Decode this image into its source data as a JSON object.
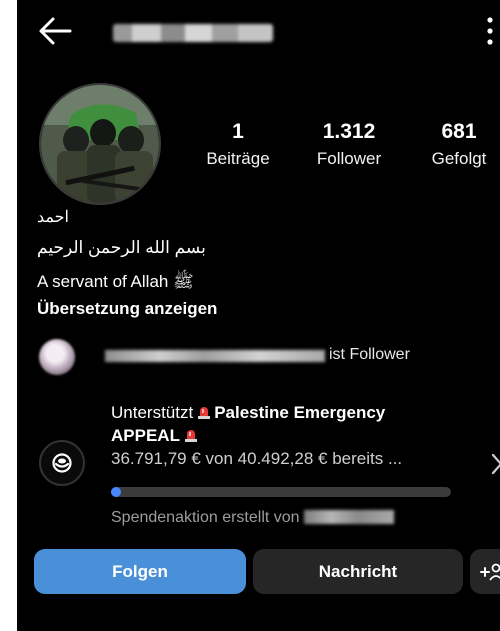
{
  "header": {
    "back_icon": "arrow-left-icon",
    "more_icon": "more-vertical-icon"
  },
  "profile": {
    "stats": [
      {
        "value": "1",
        "label": "Beiträge"
      },
      {
        "value": "1.312",
        "label": "Follower"
      },
      {
        "value": "681",
        "label": "Gefolgt"
      }
    ],
    "name": "احمد",
    "bio_line1": "بسم الله الرحمن الرحيم",
    "bio_line2": "A servant of Allah ﷺ",
    "translate_link": "Übersetzung anzeigen"
  },
  "followed_by": {
    "text": "ist Follower"
  },
  "fundraiser": {
    "prefix": "Unterstützt",
    "name_part1": "Palestine Emergency",
    "name_part2": "APPEAL",
    "amount": "36.791,79 € von 40.492,28 € bereits ...",
    "progress_fraction": 0.03,
    "creator_prefix": "Spendenaktion erstellt von",
    "accent_color": "#4a86ff"
  },
  "actions": {
    "follow_label": "Folgen",
    "message_label": "Nachricht",
    "add_icon": "add-person-icon",
    "follow_color": "#4a90d9"
  }
}
